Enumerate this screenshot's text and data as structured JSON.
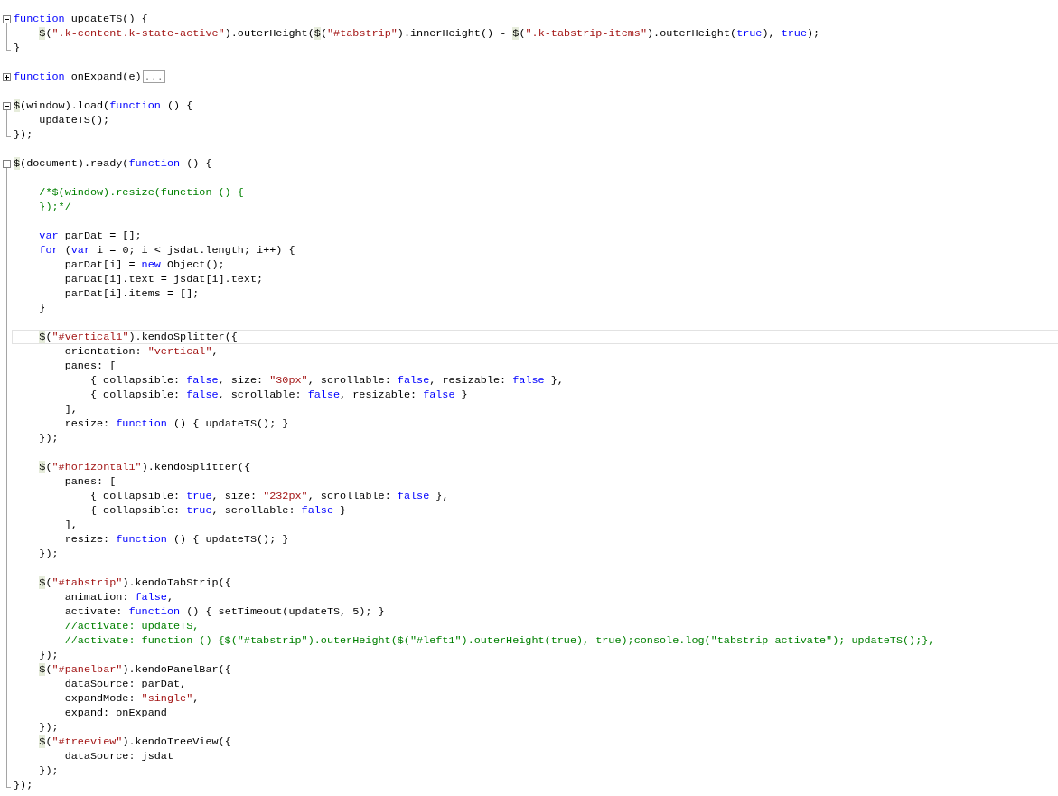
{
  "lines": [
    {
      "kind": "open",
      "current": false,
      "tokens": [
        {
          "kind": "keyword",
          "text": "function"
        },
        {
          "kind": "plain",
          "text": " updateTS() {"
        }
      ]
    },
    {
      "kind": "inside",
      "current": false,
      "tokens": [
        {
          "kind": "jq",
          "text": "    $"
        },
        {
          "kind": "plain",
          "text": "("
        },
        {
          "kind": "string",
          "text": "\".k-content.k-state-active\""
        },
        {
          "kind": "plain",
          "text": ").outerHeight("
        },
        {
          "kind": "jq",
          "text": "$"
        },
        {
          "kind": "plain",
          "text": "("
        },
        {
          "kind": "string",
          "text": "\"#tabstrip\""
        },
        {
          "kind": "plain",
          "text": ").innerHeight() - "
        },
        {
          "kind": "jq",
          "text": "$"
        },
        {
          "kind": "plain",
          "text": "("
        },
        {
          "kind": "string",
          "text": "\".k-tabstrip-items\""
        },
        {
          "kind": "plain",
          "text": ").outerHeight("
        },
        {
          "kind": "keyword",
          "text": "true"
        },
        {
          "kind": "plain",
          "text": "), "
        },
        {
          "kind": "keyword",
          "text": "true"
        },
        {
          "kind": "plain",
          "text": ");"
        }
      ]
    },
    {
      "kind": "end",
      "current": false,
      "tokens": [
        {
          "kind": "plain",
          "text": "}"
        }
      ]
    },
    {
      "current": false
    },
    {
      "kind": "closed",
      "current": false,
      "tokens": [
        {
          "kind": "keyword",
          "text": "function"
        },
        {
          "kind": "plain",
          "text": " onExpand(e)"
        }
      ],
      "collapsed": "..."
    },
    {
      "current": false
    },
    {
      "kind": "open",
      "current": false,
      "tokens": [
        {
          "kind": "jq",
          "text": "$"
        },
        {
          "kind": "plain",
          "text": "(window).load("
        },
        {
          "kind": "keyword",
          "text": "function"
        },
        {
          "kind": "plain",
          "text": " () {"
        }
      ]
    },
    {
      "kind": "inside",
      "current": false,
      "tokens": [
        {
          "kind": "plain",
          "text": "    updateTS();"
        }
      ]
    },
    {
      "kind": "end",
      "current": false,
      "tokens": [
        {
          "kind": "plain",
          "text": "});"
        }
      ]
    },
    {
      "current": false
    },
    {
      "kind": "open",
      "current": false,
      "tokens": [
        {
          "kind": "jq",
          "text": "$"
        },
        {
          "kind": "plain",
          "text": "(document).ready("
        },
        {
          "kind": "keyword",
          "text": "function"
        },
        {
          "kind": "plain",
          "text": " () {"
        }
      ]
    },
    {
      "kind": "inside",
      "current": false
    },
    {
      "kind": "inside",
      "current": false,
      "tokens": [
        {
          "kind": "comment",
          "text": "    /*$(window).resize(function () {"
        }
      ]
    },
    {
      "kind": "inside",
      "current": false,
      "tokens": [
        {
          "kind": "comment",
          "text": "    });*/"
        }
      ]
    },
    {
      "kind": "inside",
      "current": false
    },
    {
      "kind": "inside",
      "current": false,
      "tokens": [
        {
          "kind": "keyword",
          "text": "    var"
        },
        {
          "kind": "plain",
          "text": " parDat = [];"
        }
      ]
    },
    {
      "kind": "inside",
      "current": false,
      "tokens": [
        {
          "kind": "keyword",
          "text": "    for"
        },
        {
          "kind": "plain",
          "text": " ("
        },
        {
          "kind": "keyword",
          "text": "var"
        },
        {
          "kind": "plain",
          "text": " i = 0; i < jsdat.length; i++) {"
        }
      ]
    },
    {
      "kind": "inside",
      "current": false,
      "tokens": [
        {
          "kind": "plain",
          "text": "        parDat[i] = "
        },
        {
          "kind": "keyword",
          "text": "new"
        },
        {
          "kind": "plain",
          "text": " Object();"
        }
      ]
    },
    {
      "kind": "inside",
      "current": false,
      "tokens": [
        {
          "kind": "plain",
          "text": "        parDat[i].text = jsdat[i].text;"
        }
      ]
    },
    {
      "kind": "inside",
      "current": false,
      "tokens": [
        {
          "kind": "plain",
          "text": "        parDat[i].items = [];"
        }
      ]
    },
    {
      "kind": "inside",
      "current": false,
      "tokens": [
        {
          "kind": "plain",
          "text": "    }"
        }
      ]
    },
    {
      "kind": "inside",
      "current": false
    },
    {
      "kind": "inside",
      "current": true,
      "tokens": [
        {
          "kind": "jq",
          "text": "    $"
        },
        {
          "kind": "plain",
          "text": "("
        },
        {
          "kind": "string",
          "text": "\"#vertical1\""
        },
        {
          "kind": "plain",
          "text": ").kendoSplitter({"
        }
      ]
    },
    {
      "kind": "inside",
      "current": false,
      "tokens": [
        {
          "kind": "plain",
          "text": "        orientation: "
        },
        {
          "kind": "string",
          "text": "\"vertical\""
        },
        {
          "kind": "plain",
          "text": ","
        }
      ]
    },
    {
      "kind": "inside",
      "current": false,
      "tokens": [
        {
          "kind": "plain",
          "text": "        panes: ["
        }
      ]
    },
    {
      "kind": "inside",
      "current": false,
      "tokens": [
        {
          "kind": "plain",
          "text": "            { collapsible: "
        },
        {
          "kind": "keyword",
          "text": "false"
        },
        {
          "kind": "plain",
          "text": ", size: "
        },
        {
          "kind": "string",
          "text": "\"30px\""
        },
        {
          "kind": "plain",
          "text": ", scrollable: "
        },
        {
          "kind": "keyword",
          "text": "false"
        },
        {
          "kind": "plain",
          "text": ", resizable: "
        },
        {
          "kind": "keyword",
          "text": "false"
        },
        {
          "kind": "plain",
          "text": " },"
        }
      ]
    },
    {
      "kind": "inside",
      "current": false,
      "tokens": [
        {
          "kind": "plain",
          "text": "            { collapsible: "
        },
        {
          "kind": "keyword",
          "text": "false"
        },
        {
          "kind": "plain",
          "text": ", scrollable: "
        },
        {
          "kind": "keyword",
          "text": "false"
        },
        {
          "kind": "plain",
          "text": ", resizable: "
        },
        {
          "kind": "keyword",
          "text": "false"
        },
        {
          "kind": "plain",
          "text": " }"
        }
      ]
    },
    {
      "kind": "inside",
      "current": false,
      "tokens": [
        {
          "kind": "plain",
          "text": "        ],"
        }
      ]
    },
    {
      "kind": "inside",
      "current": false,
      "tokens": [
        {
          "kind": "plain",
          "text": "        resize: "
        },
        {
          "kind": "keyword",
          "text": "function"
        },
        {
          "kind": "plain",
          "text": " () { updateTS(); }"
        }
      ]
    },
    {
      "kind": "inside",
      "current": false,
      "tokens": [
        {
          "kind": "plain",
          "text": "    });"
        }
      ]
    },
    {
      "kind": "inside",
      "current": false
    },
    {
      "kind": "inside",
      "current": false,
      "tokens": [
        {
          "kind": "jq",
          "text": "    $"
        },
        {
          "kind": "plain",
          "text": "("
        },
        {
          "kind": "string",
          "text": "\"#horizontal1\""
        },
        {
          "kind": "plain",
          "text": ").kendoSplitter({"
        }
      ]
    },
    {
      "kind": "inside",
      "current": false,
      "tokens": [
        {
          "kind": "plain",
          "text": "        panes: ["
        }
      ]
    },
    {
      "kind": "inside",
      "current": false,
      "tokens": [
        {
          "kind": "plain",
          "text": "            { collapsible: "
        },
        {
          "kind": "keyword",
          "text": "true"
        },
        {
          "kind": "plain",
          "text": ", size: "
        },
        {
          "kind": "string",
          "text": "\"232px\""
        },
        {
          "kind": "plain",
          "text": ", scrollable: "
        },
        {
          "kind": "keyword",
          "text": "false"
        },
        {
          "kind": "plain",
          "text": " },"
        }
      ]
    },
    {
      "kind": "inside",
      "current": false,
      "tokens": [
        {
          "kind": "plain",
          "text": "            { collapsible: "
        },
        {
          "kind": "keyword",
          "text": "true"
        },
        {
          "kind": "plain",
          "text": ", scrollable: "
        },
        {
          "kind": "keyword",
          "text": "false"
        },
        {
          "kind": "plain",
          "text": " }"
        }
      ]
    },
    {
      "kind": "inside",
      "current": false,
      "tokens": [
        {
          "kind": "plain",
          "text": "        ],"
        }
      ]
    },
    {
      "kind": "inside",
      "current": false,
      "tokens": [
        {
          "kind": "plain",
          "text": "        resize: "
        },
        {
          "kind": "keyword",
          "text": "function"
        },
        {
          "kind": "plain",
          "text": " () { updateTS(); }"
        }
      ]
    },
    {
      "kind": "inside",
      "current": false,
      "tokens": [
        {
          "kind": "plain",
          "text": "    });"
        }
      ]
    },
    {
      "kind": "inside",
      "current": false
    },
    {
      "kind": "inside",
      "current": false,
      "tokens": [
        {
          "kind": "jq",
          "text": "    $"
        },
        {
          "kind": "plain",
          "text": "("
        },
        {
          "kind": "string",
          "text": "\"#tabstrip\""
        },
        {
          "kind": "plain",
          "text": ").kendoTabStrip({"
        }
      ]
    },
    {
      "kind": "inside",
      "current": false,
      "tokens": [
        {
          "kind": "plain",
          "text": "        animation: "
        },
        {
          "kind": "keyword",
          "text": "false"
        },
        {
          "kind": "plain",
          "text": ","
        }
      ]
    },
    {
      "kind": "inside",
      "current": false,
      "tokens": [
        {
          "kind": "plain",
          "text": "        activate: "
        },
        {
          "kind": "keyword",
          "text": "function"
        },
        {
          "kind": "plain",
          "text": " () { setTimeout(updateTS, 5); }"
        }
      ]
    },
    {
      "kind": "inside",
      "current": false,
      "tokens": [
        {
          "kind": "comment",
          "text": "        //activate: updateTS,"
        }
      ]
    },
    {
      "kind": "inside",
      "current": false,
      "tokens": [
        {
          "kind": "comment",
          "text": "        //activate: function () {$(\"#tabstrip\").outerHeight($(\"#left1\").outerHeight(true), true);console.log(\"tabstrip activate\"); updateTS();},"
        }
      ]
    },
    {
      "kind": "inside",
      "current": false,
      "tokens": [
        {
          "kind": "plain",
          "text": "    });"
        }
      ]
    },
    {
      "kind": "inside",
      "current": false,
      "tokens": [
        {
          "kind": "jq",
          "text": "    $"
        },
        {
          "kind": "plain",
          "text": "("
        },
        {
          "kind": "string",
          "text": "\"#panelbar\""
        },
        {
          "kind": "plain",
          "text": ").kendoPanelBar({"
        }
      ]
    },
    {
      "kind": "inside",
      "current": false,
      "tokens": [
        {
          "kind": "plain",
          "text": "        dataSource: parDat,"
        }
      ]
    },
    {
      "kind": "inside",
      "current": false,
      "tokens": [
        {
          "kind": "plain",
          "text": "        expandMode: "
        },
        {
          "kind": "string",
          "text": "\"single\""
        },
        {
          "kind": "plain",
          "text": ","
        }
      ]
    },
    {
      "kind": "inside",
      "current": false,
      "tokens": [
        {
          "kind": "plain",
          "text": "        expand: onExpand"
        }
      ]
    },
    {
      "kind": "inside",
      "current": false,
      "tokens": [
        {
          "kind": "plain",
          "text": "    });"
        }
      ]
    },
    {
      "kind": "inside",
      "current": false,
      "tokens": [
        {
          "kind": "jq",
          "text": "    $"
        },
        {
          "kind": "plain",
          "text": "("
        },
        {
          "kind": "string",
          "text": "\"#treeview\""
        },
        {
          "kind": "plain",
          "text": ").kendoTreeView({"
        }
      ]
    },
    {
      "kind": "inside",
      "current": false,
      "tokens": [
        {
          "kind": "plain",
          "text": "        dataSource: jsdat"
        }
      ]
    },
    {
      "kind": "inside",
      "current": false,
      "tokens": [
        {
          "kind": "plain",
          "text": "    });"
        }
      ]
    },
    {
      "kind": "end",
      "current": false,
      "tokens": [
        {
          "kind": "plain",
          "text": "});"
        }
      ]
    }
  ]
}
